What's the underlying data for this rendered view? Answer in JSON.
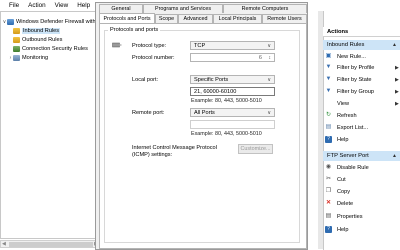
{
  "menu": [
    "File",
    "Action",
    "View",
    "Help"
  ],
  "tree": {
    "root": "Windows Defender Firewall with",
    "items": [
      "Inbound Rules",
      "Outbound Rules",
      "Connection Security Rules",
      "Monitoring"
    ]
  },
  "dialog": {
    "tabs_row1": [
      "General",
      "Programs and Services",
      "Remote Computers"
    ],
    "tabs_row2": [
      "Protocols and Ports",
      "Scope",
      "Advanced",
      "Local Principals",
      "Remote Users"
    ],
    "group_title": "Protocols and ports",
    "protocol_type_label": "Protocol type:",
    "protocol_type_value": "TCP",
    "protocol_number_label": "Protocol number:",
    "protocol_number_value": "6",
    "local_port_label": "Local port:",
    "local_port_value": "Specific Ports",
    "local_port_text": "21, 60000-60100",
    "local_port_example": "Example: 80, 443, 5000-5010",
    "remote_port_label": "Remote port:",
    "remote_port_value": "All Ports",
    "remote_port_example": "Example: 80, 443, 5000-5010",
    "icmp_label_line1": "Internet Control Message Protocol",
    "icmp_label_line2": "(ICMP) settings:",
    "customize_button": "Customize..."
  },
  "actions": {
    "header": "Actions",
    "section1": "Inbound Rules",
    "section1_items": [
      {
        "label": "New Rule...",
        "icon": "new-rule-icon",
        "submenu": false
      },
      {
        "label": "Filter by Profile",
        "icon": "filter-icon",
        "submenu": true
      },
      {
        "label": "Filter by State",
        "icon": "filter-icon",
        "submenu": true
      },
      {
        "label": "Filter by Group",
        "icon": "filter-icon",
        "submenu": true
      },
      {
        "label": "View",
        "icon": "",
        "submenu": true
      },
      {
        "label": "Refresh",
        "icon": "refresh-icon",
        "submenu": false
      },
      {
        "label": "Export List...",
        "icon": "export-icon",
        "submenu": false
      },
      {
        "label": "Help",
        "icon": "help-icon",
        "submenu": false
      }
    ],
    "section2": "FTP Server Port",
    "section2_items": [
      {
        "label": "Disable Rule",
        "icon": "disable-icon"
      },
      {
        "label": "Cut",
        "icon": "cut-icon"
      },
      {
        "label": "Copy",
        "icon": "copy-icon"
      },
      {
        "label": "Delete",
        "icon": "delete-icon"
      },
      {
        "label": "Properties",
        "icon": "properties-icon"
      },
      {
        "label": "Help",
        "icon": "help-icon"
      }
    ]
  },
  "colors": {
    "selection": "#cce4f7",
    "section_header": "#cde4f7",
    "delete_red": "#d93025",
    "help_blue": "#2e6bb0"
  }
}
